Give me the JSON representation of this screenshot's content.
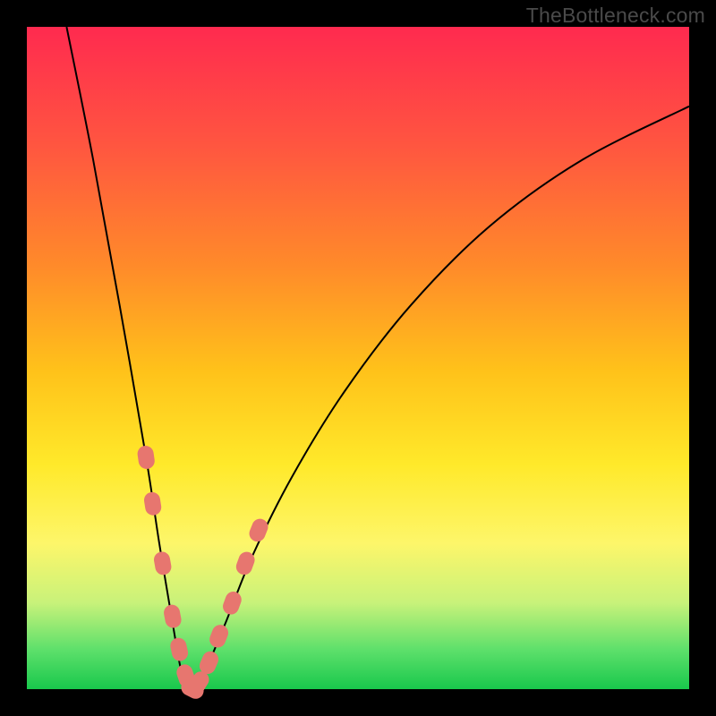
{
  "watermark": "TheBottleneck.com",
  "colors": {
    "page_bg": "#000000",
    "gradient_top": "#ff2a4f",
    "gradient_bottom": "#19c84c",
    "curve": "#000000",
    "marker": "#e7766f"
  },
  "chart_data": {
    "type": "line",
    "title": "",
    "xlabel": "",
    "ylabel": "",
    "xlim": [
      0,
      100
    ],
    "ylim": [
      0,
      100
    ],
    "note": "V-shaped bottleneck curve. x is a normalized component-balance axis (0–100); y is bottleneck severity percent (0 = no bottleneck, 100 = full bottleneck). Values estimated from pixels.",
    "series": [
      {
        "name": "bottleneck-curve",
        "x": [
          6,
          10,
          14,
          18,
          20,
          22,
          23.5,
          25,
          27,
          30,
          34,
          40,
          48,
          58,
          70,
          84,
          100
        ],
        "y": [
          100,
          80,
          58,
          35,
          22,
          10,
          2,
          0,
          3,
          10,
          20,
          32,
          45,
          58,
          70,
          80,
          88
        ]
      }
    ],
    "markers": {
      "name": "highlighted-points",
      "note": "Salmon capsule markers clustered near the valley on both arms of the V.",
      "points": [
        {
          "x": 18,
          "y": 35
        },
        {
          "x": 19,
          "y": 28
        },
        {
          "x": 20.5,
          "y": 19
        },
        {
          "x": 22,
          "y": 11
        },
        {
          "x": 23,
          "y": 6
        },
        {
          "x": 24,
          "y": 2
        },
        {
          "x": 25,
          "y": 0
        },
        {
          "x": 26,
          "y": 1
        },
        {
          "x": 27.5,
          "y": 4
        },
        {
          "x": 29,
          "y": 8
        },
        {
          "x": 31,
          "y": 13
        },
        {
          "x": 33,
          "y": 19
        },
        {
          "x": 35,
          "y": 24
        }
      ]
    }
  }
}
